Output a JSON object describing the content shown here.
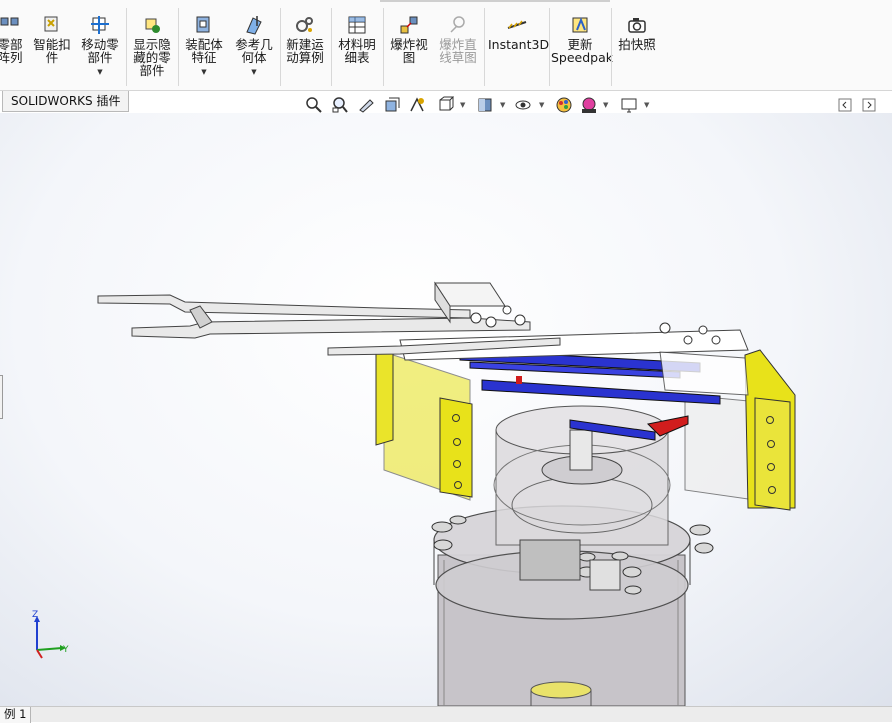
{
  "ribbon": {
    "buttons": [
      {
        "id": "linear-pattern",
        "label": "零部\n阵列",
        "icon": "linear-pattern-icon",
        "dropdown": false
      },
      {
        "id": "smart-fasteners",
        "label": "智能扣\n件",
        "icon": "smart-fasteners-icon",
        "dropdown": false
      },
      {
        "id": "move-component",
        "label": "移动零\n部件",
        "icon": "move-component-icon",
        "dropdown": true
      },
      {
        "id": "show-hidden",
        "label": "显示隐\n藏的零\n部件",
        "icon": "show-hidden-icon",
        "dropdown": false
      },
      {
        "id": "assembly-features",
        "label": "装配体\n特征",
        "icon": "assembly-features-icon",
        "dropdown": true
      },
      {
        "id": "reference-geometry",
        "label": "参考几\n何体",
        "icon": "reference-geometry-icon",
        "dropdown": true
      },
      {
        "id": "new-motion-study",
        "label": "新建运\n动算例",
        "icon": "motion-study-icon",
        "dropdown": false
      },
      {
        "id": "bill-of-materials",
        "label": "材料明\n细表",
        "icon": "bom-icon",
        "dropdown": false
      },
      {
        "id": "exploded-view",
        "label": "爆炸视\n图",
        "icon": "exploded-view-icon",
        "dropdown": false
      },
      {
        "id": "explode-line-sketch",
        "label": "爆炸直\n线草图",
        "icon": "explode-line-icon",
        "dropdown": false,
        "disabled": true
      },
      {
        "id": "instant3d",
        "label": "Instant3D",
        "icon": "instant3d-icon",
        "dropdown": false
      },
      {
        "id": "update-speedpak",
        "label": "更新\nSpeedpak",
        "icon": "speedpak-icon",
        "dropdown": false
      },
      {
        "id": "take-snapshot",
        "label": "拍快照",
        "icon": "camera-icon",
        "dropdown": false
      }
    ]
  },
  "tabs": {
    "addins_label": "SOLIDWORKS 插件"
  },
  "heads_up_toolbar": {
    "items": [
      "zoom-to-fit-icon",
      "zoom-to-area-icon",
      "previous-view-icon",
      "section-view-icon",
      "dynamic-annotation-icon",
      "view-orientation-icon",
      "display-style-icon",
      "hide-show-icon",
      "edit-appearance-icon",
      "apply-scene-icon",
      "view-settings-icon"
    ]
  },
  "status": {
    "tab_label": "例 1"
  },
  "triad": {
    "x": "Y",
    "z": "Z"
  },
  "colors": {
    "accent_yellow": "#e8e21a",
    "accent_blue": "#2a33d0",
    "accent_red": "#d11d1d"
  }
}
